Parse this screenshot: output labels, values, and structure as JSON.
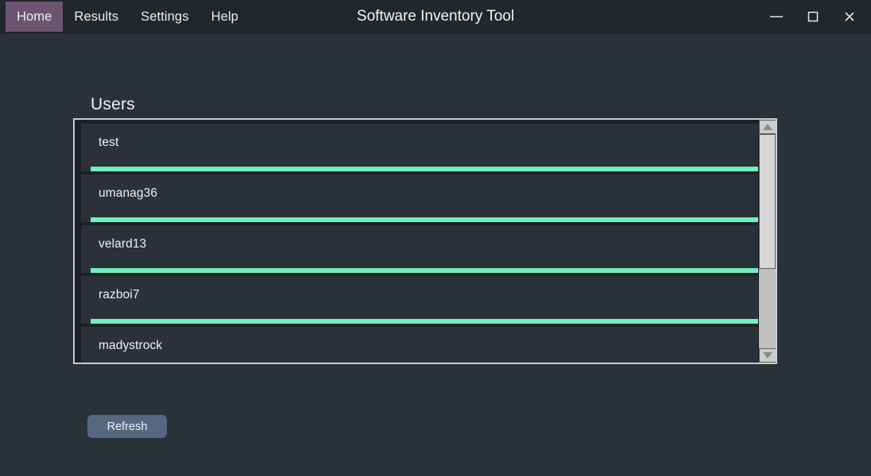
{
  "window": {
    "title": "Software Inventory Tool",
    "accent_purple": "#6b5570",
    "accent_green": "#6ff0bf",
    "background": "#2b3138",
    "titlebar_background": "#22272c"
  },
  "menu": {
    "items": [
      {
        "label": "Home",
        "active": true
      },
      {
        "label": "Results",
        "active": false
      },
      {
        "label": "Settings",
        "active": false
      },
      {
        "label": "Help",
        "active": false
      }
    ]
  },
  "window_controls": {
    "minimize": "minimize-icon",
    "maximize": "maximize-icon",
    "close": "close-icon"
  },
  "main": {
    "section_title": "Users",
    "users": [
      {
        "name": "test"
      },
      {
        "name": "umanag36"
      },
      {
        "name": "velard13"
      },
      {
        "name": "razboi7"
      },
      {
        "name": "madystrock"
      }
    ],
    "refresh_label": "Refresh"
  },
  "scrollbar": {
    "up_icon": "chevron-up-icon",
    "down_icon": "chevron-down-icon"
  }
}
